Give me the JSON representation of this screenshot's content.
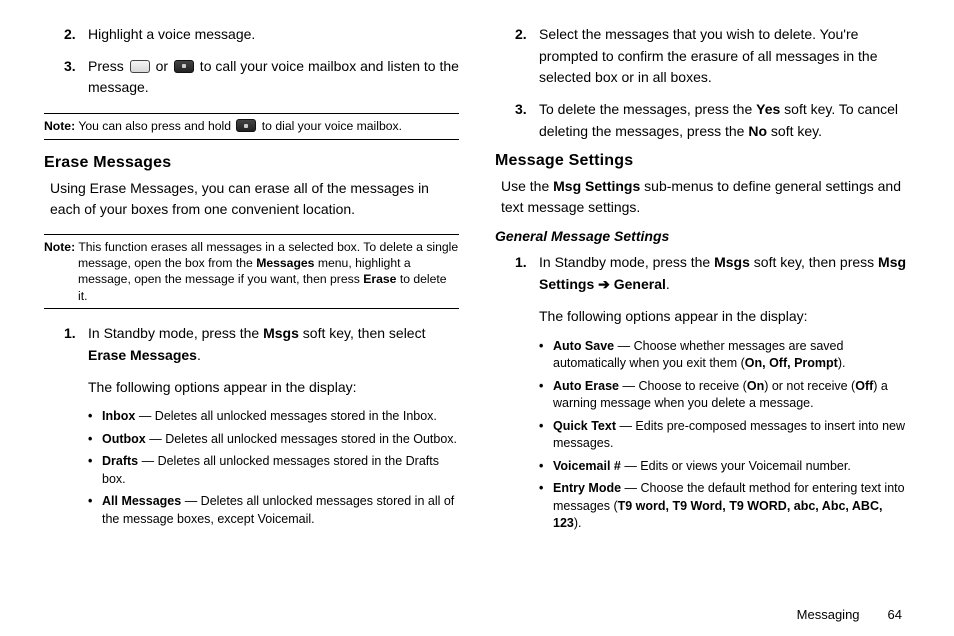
{
  "left": {
    "step2": {
      "num": "2.",
      "text": "Highlight a voice message."
    },
    "step3": {
      "num": "3.",
      "pre": "Press ",
      "mid": " or ",
      "post": " to call your voice mailbox and listen to the message."
    },
    "note1": {
      "label": "Note:",
      "pre": " You can also press and hold ",
      "post": " to dial your voice mailbox."
    },
    "h_erase": "Erase Messages",
    "erase_intro": "Using Erase Messages, you can erase all of the messages in each of your boxes from one convenient location.",
    "note2": {
      "label": "Note:",
      "text": " This function erases all messages in a selected box. To delete a single message, open the box from the ",
      "b1": "Messages",
      "text2": " menu, highlight a message, open the message if you want, then press ",
      "b2": "Erase",
      "text3": " to delete it."
    },
    "erase_step1": {
      "num": "1.",
      "t1": "In Standby mode, press the ",
      "b1": "Msgs",
      "t2": " soft key, then select ",
      "b2": "Erase Messages",
      "t3": ".",
      "follow": "The following options appear in the display:"
    },
    "bullets": [
      {
        "b": "Inbox",
        "t": " — Deletes all unlocked messages stored in the Inbox."
      },
      {
        "b": "Outbox",
        "t": " — Deletes all unlocked messages stored in the Outbox."
      },
      {
        "b": "Drafts",
        "t": " — Deletes all unlocked messages stored in the Drafts box."
      },
      {
        "b": "All Messages",
        "t": " — Deletes all unlocked messages stored in all of the message boxes, except Voicemail."
      }
    ]
  },
  "right": {
    "step2": {
      "num": "2.",
      "text": "Select the messages that you wish to delete. You're prompted to confirm the erasure of all messages in the selected box or in all boxes."
    },
    "step3": {
      "num": "3.",
      "t1": "To delete the messages, press the ",
      "b1": "Yes",
      "t2": " soft key. To cancel deleting the messages, press the ",
      "b2": "No",
      "t3": " soft key."
    },
    "h_settings": "Message Settings",
    "settings_intro_t1": "Use the ",
    "settings_intro_b1": "Msg Settings",
    "settings_intro_t2": " sub-menus to define general settings and text message settings.",
    "h_general": "General Message Settings",
    "gen_step1": {
      "num": "1.",
      "t1": "In Standby mode, press the ",
      "b1": "Msgs",
      "t2": " soft key, then press ",
      "b2": "Msg Settings",
      "arrow": " ➔ ",
      "b3": "General",
      "t3": ".",
      "follow": "The following options appear in the display:"
    },
    "bullets": [
      {
        "b": "Auto Save",
        "t1": " — Choose whether messages are saved automatically when you exit them (",
        "opts": "On, Off, Prompt",
        "t2": ")."
      },
      {
        "b": "Auto Erase",
        "t1": " — Choose to receive (",
        "o1": "On",
        "t2": ") or not receive (",
        "o2": "Off",
        "t3": ") a warning message when you delete a message."
      },
      {
        "b": "Quick Text",
        "t": " — Edits pre-composed messages to insert into new messages."
      },
      {
        "b": "Voicemail #",
        "t": " — Edits or views your Voicemail number."
      },
      {
        "b": "Entry Mode",
        "t1": " — Choose the default method for entering text into messages (",
        "opts": "T9 word, T9 Word, T9 WORD, abc, Abc, ABC, 123",
        "t2": ")."
      }
    ]
  },
  "footer": {
    "section": "Messaging",
    "page": "64"
  }
}
